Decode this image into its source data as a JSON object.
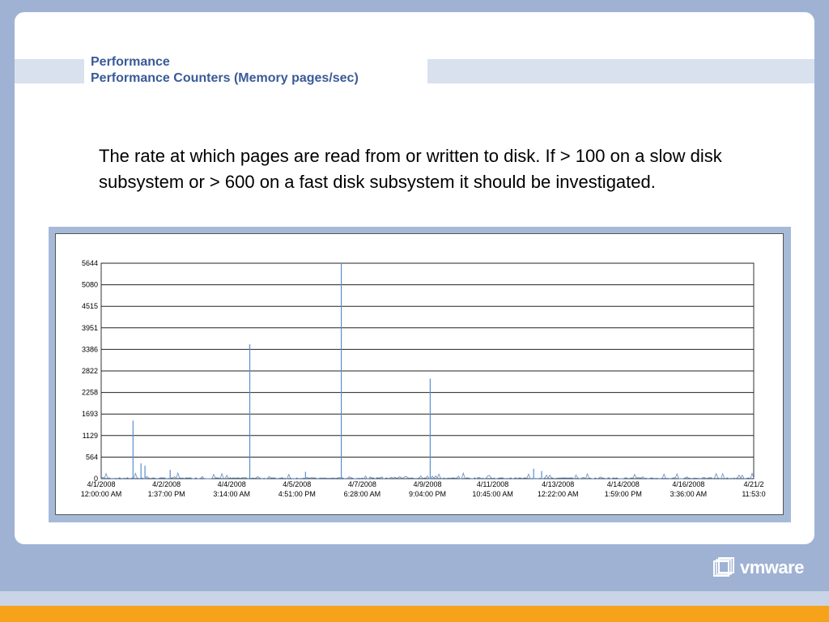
{
  "slide": {
    "title_line1": "Performance",
    "title_line2": "Performance Counters (Memory pages/sec)",
    "body": "The rate at which pages are read from or written to disk.  If > 100 on a slow disk subsystem or > 600 on a fast disk subsystem it should be investigated."
  },
  "logo": {
    "text": "vmware",
    "icon": "vmware-logo-icon"
  },
  "colors": {
    "background": "#9fb2d4",
    "title": "#3a5a98",
    "band": "#d9e1ee",
    "orange": "#f7a21b",
    "series": "#5b8ed0"
  },
  "chart_data": {
    "type": "line",
    "title": "",
    "xlabel": "",
    "ylabel": "",
    "ylim": [
      0,
      5644
    ],
    "y_ticks": [
      "0",
      "564",
      "1129",
      "1693",
      "2258",
      "2822",
      "3386",
      "3951",
      "4515",
      "5080",
      "5644"
    ],
    "grid": true,
    "x_ticks": [
      {
        "date": "4/1/2008",
        "time": "12:00:00 AM"
      },
      {
        "date": "4/2/2008",
        "time": "1:37:00 PM"
      },
      {
        "date": "4/4/2008",
        "time": "3:14:00 AM"
      },
      {
        "date": "4/5/2008",
        "time": "4:51:00 PM"
      },
      {
        "date": "4/7/2008",
        "time": "6:28:00 AM"
      },
      {
        "date": "4/9/2008",
        "time": "9:04:00 PM"
      },
      {
        "date": "4/11/2008",
        "time": "10:45:00 AM"
      },
      {
        "date": "4/13/2008",
        "time": "12:22:00 AM"
      },
      {
        "date": "4/14/2008",
        "time": "1:59:00 PM"
      },
      {
        "date": "4/16/2008",
        "time": "3:36:00 AM"
      },
      {
        "date": "4/21/2",
        "time": "11:53:0"
      }
    ],
    "series": [
      {
        "values_at_ticks_note": "",
        "spikes": [
          {
            "at": "4/2/2008 12:00 AM",
            "value": 1520
          },
          {
            "at": "4/5/2008 4:00 PM",
            "value": 3520
          },
          {
            "at": "4/8/2008 1:00 PM",
            "value": 5644
          },
          {
            "at": "4/11/2008 8:00 AM",
            "value": 2620
          },
          {
            "at": "4/2/2008 6:00 AM",
            "value": 400
          },
          {
            "at": "4/2/2008 9:00 AM",
            "value": 340
          },
          {
            "at": "4/3/2008 4:00 AM",
            "value": 230
          },
          {
            "at": "4/7/2008 10:00 AM",
            "value": 180
          },
          {
            "at": "4/14/2008 2:00 PM",
            "value": 260
          },
          {
            "at": "4/14/2008 8:00 PM",
            "value": 200
          }
        ]
      }
    ]
  }
}
